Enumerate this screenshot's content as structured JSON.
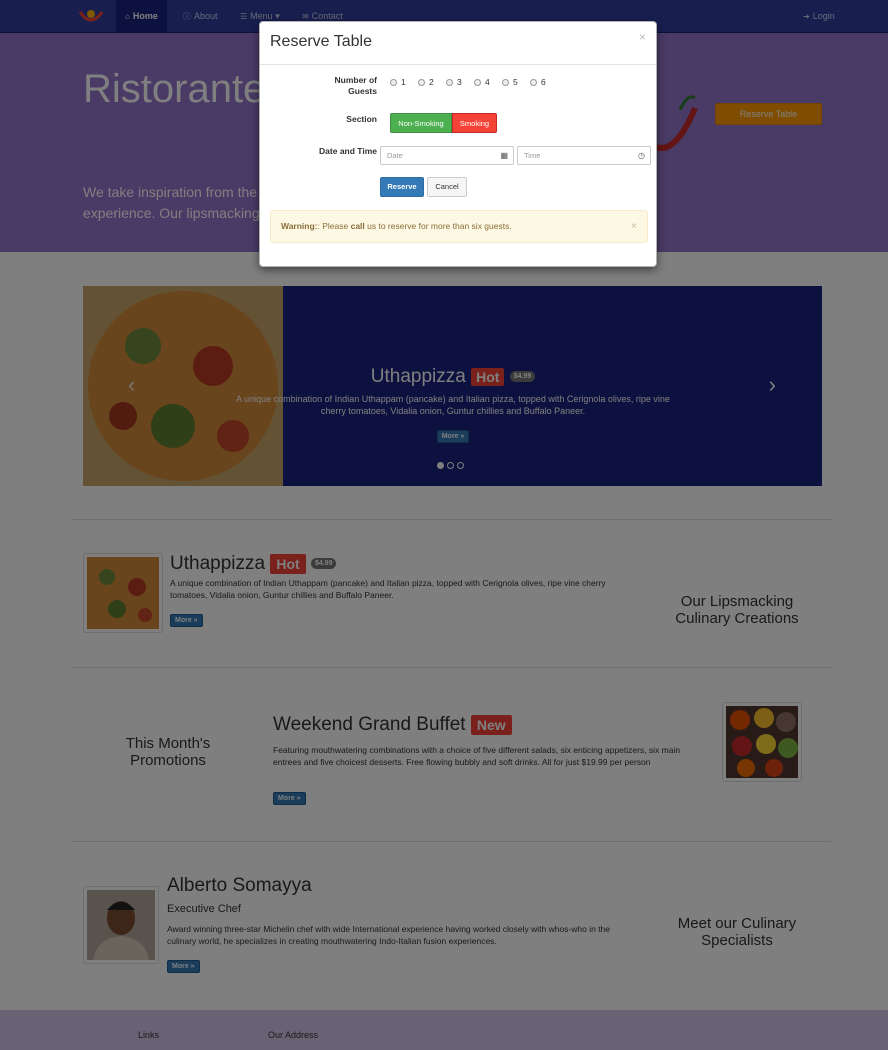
{
  "navbar": {
    "items": [
      {
        "label": "Home",
        "icon": "home-icon"
      },
      {
        "label": "About",
        "icon": "info-icon"
      },
      {
        "label": "Menu",
        "icon": "list-icon"
      },
      {
        "label": "Contact",
        "icon": "envelope-icon"
      }
    ],
    "login": "Login"
  },
  "jumbotron": {
    "title": "Ristorante con Fusion",
    "text": "We take inspiration from the World's best cuisines, and create a unique fusion experience. Our lipsmacking creations will tickle your culinary senses!",
    "reserve_label": "Reserve Table"
  },
  "carousel": {
    "title": "Uthappizza",
    "badge": "Hot",
    "price": "$4.99",
    "desc": "A unique combination of Indian Uthappam (pancake) and Italian pizza, topped with Cerignola olives, ripe vine cherry tomatoes, Vidalia onion, Guntur chillies and Buffalo Paneer.",
    "more": "More »",
    "slide_count": 3
  },
  "dish": {
    "title": "Uthappizza",
    "badge": "Hot",
    "price": "$4.99",
    "desc": "A unique combination of Indian Uthappam (pancake) and Italian pizza, topped with Cerignola olives, ripe vine cherry tomatoes, Vidalia onion, Guntur chillies and Buffalo Paneer.",
    "more": "More »",
    "side": "Our Lipsmacking Culinary Creations"
  },
  "promo": {
    "side": "This Month's Promotions",
    "title": "Weekend Grand Buffet",
    "badge": "New",
    "desc": "Featuring mouthwatering combinations with a choice of five different salads, six enticing appetizers, six main entrees and five choicest desserts. Free flowing bubbly and soft drinks. All for just $19.99 per person",
    "more": "More »"
  },
  "chef": {
    "name": "Alberto Somayya",
    "role": "Executive Chef",
    "desc": "Award winning three-star Michelin chef with wide International experience having worked closely with whos-who in the culinary world, he specializes in creating mouthwatering Indo-Italian fusion experiences.",
    "more": "More »",
    "side": "Meet our Culinary Specialists"
  },
  "footer": {
    "links": "Links",
    "address": "Our Address"
  },
  "modal": {
    "title": "Reserve Table",
    "guests_label": "Number of Guests",
    "guest_options": [
      "1",
      "2",
      "3",
      "4",
      "5",
      "6"
    ],
    "section_label": "Section",
    "section_options": [
      "Non-Smoking",
      "Smoking"
    ],
    "datetime_label": "Date and Time",
    "date_placeholder": "Date",
    "time_placeholder": "Time",
    "reserve": "Reserve",
    "cancel": "Cancel",
    "alert_strong": "Warning:",
    "alert_mid": ": Please ",
    "alert_call": "call",
    "alert_rest": " us to reserve for more than six guests."
  },
  "colors": {
    "primary": "#303F9F",
    "jumbotron": "#9575CD",
    "carousel": "#1A237E",
    "accent": "#FF9800",
    "hot": "#f44336",
    "success": "#4CAF50"
  }
}
